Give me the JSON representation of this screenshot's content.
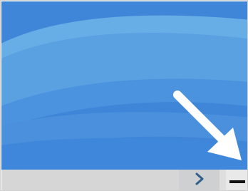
{
  "desktop": {
    "wallpaper": {
      "base_color": "#3e84d8",
      "band_colors": [
        "#5ea6e3",
        "#6bb0e8",
        "#4a8fdd",
        "#5595df"
      ]
    }
  },
  "taskbar": {
    "search_area_color": "#d6d6d6",
    "chevron_icon": "chevron-right-icon",
    "chevron_color": "#2f5f8a",
    "minimize_icon": "minus-icon"
  },
  "annotation": {
    "arrow_color": "#ffffff",
    "points_to": "minimize-button"
  }
}
